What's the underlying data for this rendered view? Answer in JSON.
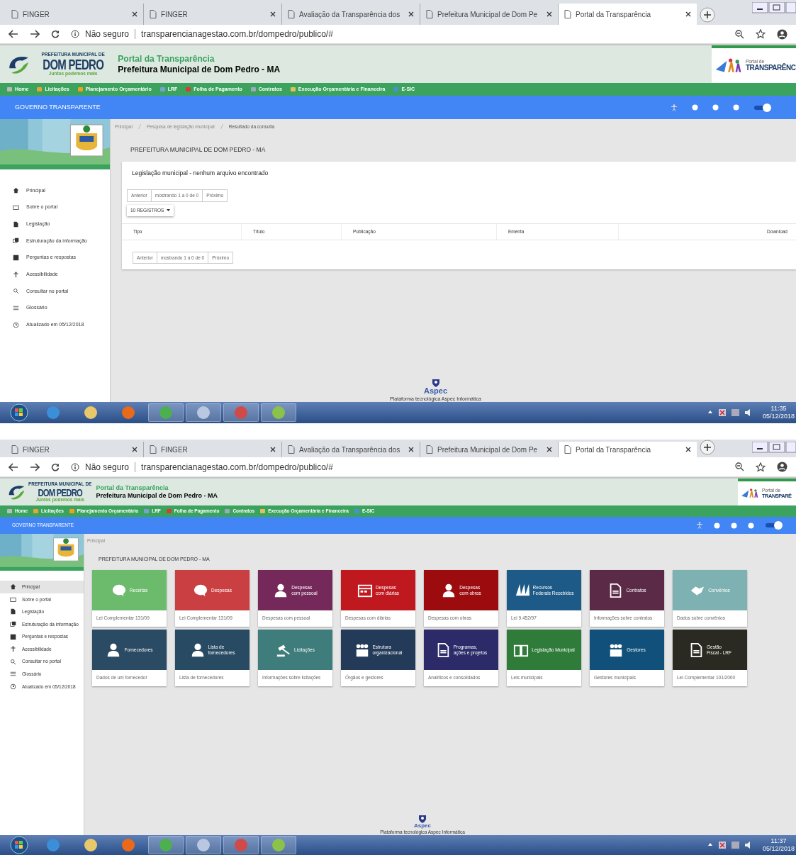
{
  "screens": [
    {
      "browser": {
        "tabs": [
          {
            "title": "FINGER",
            "selected": false
          },
          {
            "title": "FINGER",
            "selected": false
          },
          {
            "title": "Avaliação da Transparência dos",
            "selected": false
          },
          {
            "title": "Prefeitura Municipal de Dom Pe",
            "selected": false
          },
          {
            "title": "Portal da Transparência",
            "selected": true
          }
        ],
        "security": "Não seguro",
        "url": "transparencianagestao.com.br/dompedro/publico/#"
      },
      "header": {
        "logo_lines": [
          "PREFEITURA MUNICIPAL DE",
          "DOM PEDRO",
          "Juntos podemos mais"
        ],
        "title": "Portal da Transparência",
        "subtitle": "Prefeitura Municipal de Dom Pedro - MA",
        "partner_logo": [
          "Portal de",
          "TRANSPARÊNC"
        ]
      },
      "nav": [
        "Home",
        "Licitações",
        "Planejamento Orçamentário",
        "LRF",
        "Folha de Pagamento",
        "Contratos",
        "Execução Orçamentária e Financeira",
        "E-SIC"
      ],
      "top_bar": {
        "title": "GOVERNO TRANSPARENTE",
        "contrast_on": true
      },
      "sidebar": [
        {
          "label": "Principal",
          "selected": false
        },
        {
          "label": "Sobre o portal",
          "selected": false
        },
        {
          "label": "Legislação",
          "selected": false
        },
        {
          "label": "Estruturação da informação",
          "selected": false
        },
        {
          "label": "Perguntas e respostas",
          "selected": false
        },
        {
          "label": "Acessibilidade",
          "selected": false
        },
        {
          "label": "Consultar no portal",
          "selected": false
        },
        {
          "label": "Glossário",
          "selected": false
        },
        {
          "label": "Atualizado em 05/12/2018",
          "selected": false
        }
      ],
      "main": {
        "kind": "results",
        "breadcrumb": [
          "Principal",
          "Pesquisa de legislação municipal",
          "Resultado da consulta"
        ],
        "page_title": "PREFEITURA MUNICIPAL DE DOM PEDRO - MA",
        "heading": "Legislação municipal - nenhum arquivo encontrado",
        "pager_top": [
          "Anterior",
          "mostrando 1 a 0 de 0",
          "Próximo"
        ],
        "page_size": "10 REGISTROS",
        "columns": [
          "Tipo",
          "Título",
          "Publicação",
          "Ementa",
          "Download"
        ],
        "pager_bottom": [
          "Anterior",
          "mostrando 1 a 0 de 0",
          "Próximo"
        ]
      },
      "footer": {
        "logo": "Aspec",
        "text": "Plataforma tecnológica Aspec Informática"
      },
      "taskbar": {
        "time": "11:35",
        "date": "05/12/2018"
      }
    },
    {
      "browser": {
        "tabs": [
          {
            "title": "FINGER",
            "selected": false
          },
          {
            "title": "FINGER",
            "selected": false
          },
          {
            "title": "Avaliação da Transparência dos",
            "selected": false
          },
          {
            "title": "Prefeitura Municipal de Dom Pe",
            "selected": false
          },
          {
            "title": "Portal da Transparência",
            "selected": true
          }
        ],
        "security": "Não seguro",
        "url": "transparencianagestao.com.br/dompedro/publico/#"
      },
      "header": {
        "logo_lines": [
          "PREFEITURA MUNICIPAL DE",
          "DOM PEDRO",
          "Juntos podemos mais"
        ],
        "title": "Portal da Transparência",
        "subtitle": "Prefeitura Municipal de Dom Pedro - MA",
        "partner_logo": [
          "Portal de",
          "TRANSPARÊ"
        ]
      },
      "nav": [
        "Home",
        "Licitações",
        "Planejamento Orçamentário",
        "LRF",
        "Folha de Pagamento",
        "Contratos",
        "Execução Orçamentária e Financeira",
        "E-SIC"
      ],
      "top_bar": {
        "title": "GOVERNO TRANSPARENTE",
        "contrast_on": true
      },
      "sidebar": [
        {
          "label": "Principal",
          "selected": true
        },
        {
          "label": "Sobre o portal",
          "selected": false
        },
        {
          "label": "Legislação",
          "selected": false
        },
        {
          "label": "Estruturação da informação",
          "selected": false
        },
        {
          "label": "Perguntas e respostas",
          "selected": false
        },
        {
          "label": "Acessibilidade",
          "selected": false
        },
        {
          "label": "Consultar no portal",
          "selected": false
        },
        {
          "label": "Glossário",
          "selected": false
        },
        {
          "label": "Atualizado em 05/12/2018",
          "selected": false
        }
      ],
      "main": {
        "kind": "tiles",
        "breadcrumb": [
          "Principal"
        ],
        "page_title": "PREFEITURA MUNICIPAL DE DOM PEDRO - MA",
        "tiles": [
          {
            "title": "Receitas",
            "caption": "Lei Complementar 131/09",
            "color": "#6cba6c"
          },
          {
            "title": "Despesas",
            "caption": "Lei Complementar 131/09",
            "color": "#c93f42"
          },
          {
            "title": "Despesas\ncom pessoal",
            "caption": "Despesas com pessoal",
            "color": "#75285a"
          },
          {
            "title": "Despesas\ncom diárias",
            "caption": "Despesas com diárias",
            "color": "#c0181f"
          },
          {
            "title": "Despesas\ncom obras",
            "caption": "Despesas com obras",
            "color": "#9c0c0e"
          },
          {
            "title": "Recursos\nFederais Recebidos",
            "caption": "Lei 9.452/97",
            "color": "#1d5a87"
          },
          {
            "title": "Contratos",
            "caption": "Informações sobre contratos",
            "color": "#5b2a47"
          },
          {
            "title": "Convênios",
            "caption": "Dados sobre convênios",
            "color": "#7eb1b1"
          },
          {
            "title": "Fornecedores",
            "caption": "Dados de um fornecedor",
            "color": "#2b4a63"
          },
          {
            "title": "Lista de\nfornecedores",
            "caption": "Lista de fornecedores",
            "color": "#294a63"
          },
          {
            "title": "Licitações",
            "caption": "Informações sobre licitações",
            "color": "#3e7d7b"
          },
          {
            "title": "Estrutura\norganizacional",
            "caption": "Órgãos e gestores",
            "color": "#233b58"
          },
          {
            "title": "Programas,\nações e projetos",
            "caption": "Analíticos e consolidados",
            "color": "#2c2a69"
          },
          {
            "title": "Legislação Municipal",
            "caption": "Leis municipais",
            "color": "#2f7b3a"
          },
          {
            "title": "Gestores",
            "caption": "Gestores municipais",
            "color": "#11507b"
          },
          {
            "title": "Gestão\nFiscal - LRF",
            "caption": "Lei Complementar 101/2000",
            "color": "#2b2a22"
          }
        ]
      },
      "footer": {
        "logo": "Aspec",
        "text": "Plataforma tecnológica Aspec Informática"
      },
      "taskbar": {
        "time": "11:37",
        "date": "05/12/2018"
      }
    }
  ]
}
